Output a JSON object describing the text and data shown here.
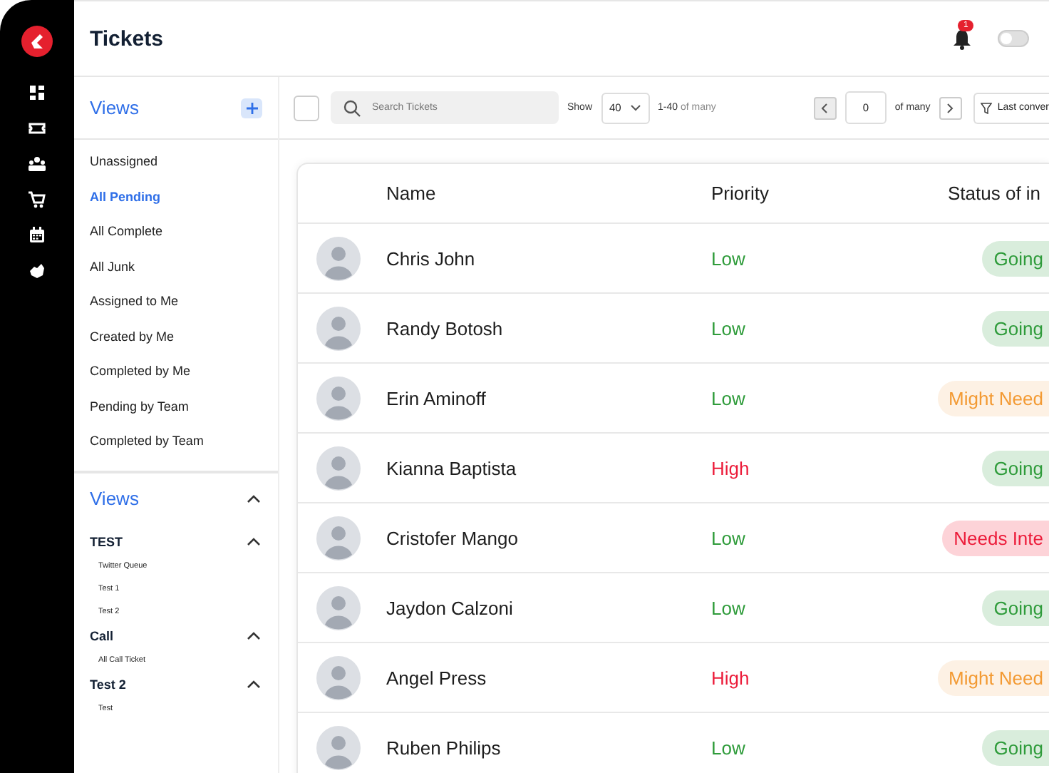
{
  "header": {
    "title": "Tickets",
    "notification_count": "1",
    "toggle": {
      "on": false
    }
  },
  "sidebar": {
    "title": "Views",
    "items": [
      {
        "label": "Unassigned",
        "selected": false
      },
      {
        "label": "All Pending",
        "selected": true
      },
      {
        "label": "All Complete",
        "selected": false
      },
      {
        "label": "All Junk",
        "selected": false
      },
      {
        "label": "Assigned to Me",
        "selected": false
      },
      {
        "label": "Created by Me",
        "selected": false
      },
      {
        "label": "Completed by Me",
        "selected": false
      },
      {
        "label": "Pending by Team",
        "selected": false
      },
      {
        "label": "Completed by Team",
        "selected": false
      }
    ],
    "views": {
      "title": "Views",
      "expanded": true,
      "groups": [
        {
          "title": "TEST",
          "expanded": true,
          "children": [
            {
              "label": "Twitter Queue"
            },
            {
              "label": "Test 1"
            },
            {
              "label": "Test 2"
            }
          ]
        },
        {
          "title": "Call",
          "expanded": true,
          "children": [
            {
              "label": "All Call Ticket"
            }
          ]
        },
        {
          "title": "Test 2",
          "expanded": true,
          "children": [
            {
              "label": "Test"
            }
          ]
        }
      ]
    }
  },
  "toolbar": {
    "select_all": {
      "checked": false
    },
    "search": {
      "placeholder": "Search Tickets"
    },
    "show_label": "Show",
    "page_size": "40",
    "range": "1-40",
    "range_suffix": "of many",
    "page": "0",
    "page_suffix": "of many",
    "sort": "Last conver"
  },
  "table": {
    "columns": [
      "Name",
      "Priority",
      "Status of in"
    ],
    "rows": [
      {
        "name": "Chris John",
        "priority": {
          "text": "Low",
          "kind": "low"
        },
        "status": {
          "text": "Going",
          "kind": "going"
        }
      },
      {
        "name": "Randy Botosh",
        "priority": {
          "text": "Low",
          "kind": "low"
        },
        "status": {
          "text": "Going",
          "kind": "going"
        }
      },
      {
        "name": "Erin Aminoff",
        "priority": {
          "text": "Low",
          "kind": "low"
        },
        "status": {
          "text": "Might Need",
          "kind": "might"
        }
      },
      {
        "name": "Kianna Baptista",
        "priority": {
          "text": "High",
          "kind": "high"
        },
        "status": {
          "text": "Going",
          "kind": "going"
        }
      },
      {
        "name": "Cristofer Mango",
        "priority": {
          "text": "Low",
          "kind": "low"
        },
        "status": {
          "text": "Needs Inte",
          "kind": "needs"
        }
      },
      {
        "name": "Jaydon Calzoni",
        "priority": {
          "text": "Low",
          "kind": "low"
        },
        "status": {
          "text": "Going",
          "kind": "going"
        }
      },
      {
        "name": "Angel Press",
        "priority": {
          "text": "High",
          "kind": "high"
        },
        "status": {
          "text": "Might Need",
          "kind": "might"
        }
      },
      {
        "name": "Ruben Philips",
        "priority": {
          "text": "Low",
          "kind": "low"
        },
        "status": {
          "text": "Going",
          "kind": "going"
        }
      }
    ]
  }
}
